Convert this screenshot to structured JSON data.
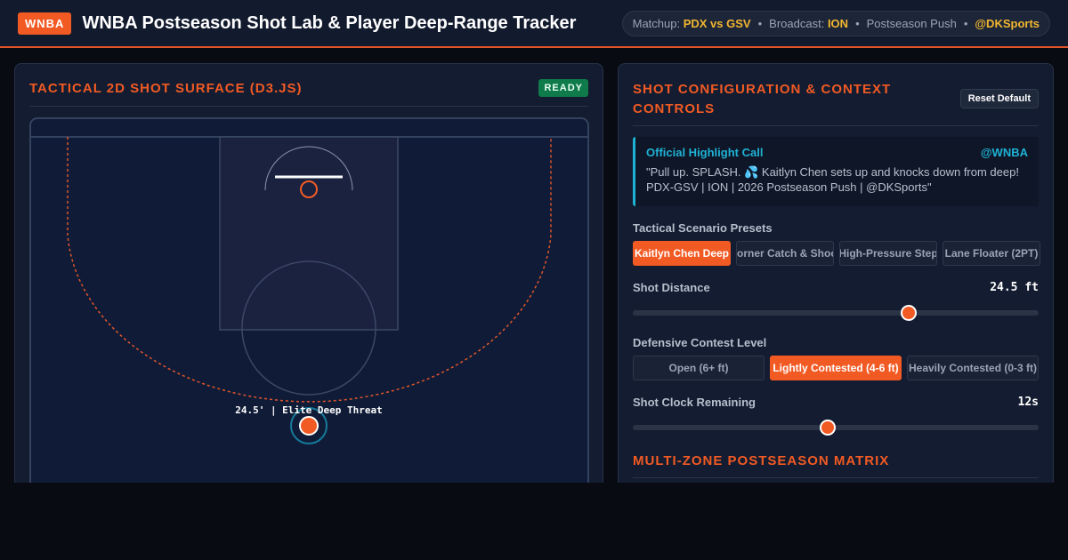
{
  "header": {
    "logo": "WNBA",
    "title": "WNBA Postseason Shot Lab & Player Deep-Range Tracker",
    "meta": {
      "matchup_label": "Matchup:",
      "matchup_value": "PDX vs GSV",
      "broadcast_label": "Broadcast:",
      "broadcast_value": "ION",
      "context": "Postseason Push",
      "handle": "@DKSports",
      "separator": "•"
    }
  },
  "left_panel": {
    "title": "TACTICAL 2D SHOT SURFACE (D3.JS)",
    "status_badge": "READY",
    "shot_label": "24.5' | Elite Deep Threat"
  },
  "right_panel": {
    "title_line1": "SHOT CONFIGURATION & CONTEXT",
    "title_line2": "CONTROLS",
    "reset_label": "Reset Default",
    "highlight": {
      "title": "Official Highlight Call",
      "handle": "@WNBA",
      "text": "\"Pull up. SPLASH. 💦 Kaitlyn Chen sets up and knocks down from deep! PDX-GSV | ION | 2026 Postseason Push | @DKSports\""
    },
    "presets": {
      "label": "Tactical Scenario Presets",
      "items": [
        {
          "label": "Kaitlyn Chen Deep",
          "active": true
        },
        {
          "label": "Corner Catch & Shoot",
          "active": false
        },
        {
          "label": "High-Pressure Step",
          "active": false
        },
        {
          "label": "Lane Floater (2PT)",
          "active": false
        }
      ]
    },
    "shot_distance": {
      "label": "Shot Distance",
      "value_text": "24.5 ft",
      "fraction": 0.68
    },
    "defense": {
      "label": "Defensive Contest Level",
      "items": [
        {
          "label": "Open (6+ ft)",
          "active": false
        },
        {
          "label": "Lightly Contested (4-6 ft)",
          "active": true
        },
        {
          "label": "Heavily Contested (0-3 ft)",
          "active": false
        }
      ]
    },
    "shot_clock": {
      "label": "Shot Clock Remaining",
      "value_text": "12s",
      "fraction": 0.48
    },
    "matrix_title": "MULTI-ZONE POSTSEASON MATRIX"
  },
  "colors": {
    "accent": "#f25a24",
    "highlight": "#f2b630",
    "cyan": "#1fb2d4",
    "ready": "#0f7a4a"
  }
}
